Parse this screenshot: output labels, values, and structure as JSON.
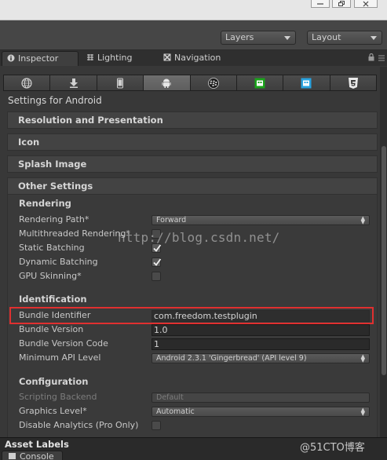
{
  "toolbar": {
    "layers_label": "Layers",
    "layout_label": "Layout"
  },
  "tabs": [
    {
      "label": "Inspector"
    },
    {
      "label": "Lighting"
    },
    {
      "label": "Navigation"
    }
  ],
  "platforms": [
    "globe-icon",
    "download-icon",
    "phone-icon",
    "android-icon",
    "blackberry-icon",
    "windows-store-green-icon",
    "windows-store-blue-icon",
    "html5-icon"
  ],
  "settings_for": "Settings for Android",
  "sections": {
    "resolution": "Resolution and Presentation",
    "icon": "Icon",
    "splash": "Splash Image",
    "other": "Other Settings"
  },
  "rendering": {
    "heading": "Rendering",
    "rendering_path_label": "Rendering Path*",
    "rendering_path_value": "Forward",
    "multithreaded_label": "Multithreaded Rendering*",
    "multithreaded_checked": false,
    "static_batching_label": "Static Batching",
    "static_batching_checked": true,
    "dynamic_batching_label": "Dynamic Batching",
    "dynamic_batching_checked": true,
    "gpu_skinning_label": "GPU Skinning*",
    "gpu_skinning_checked": false
  },
  "identification": {
    "heading": "Identification",
    "bundle_identifier_label": "Bundle Identifier",
    "bundle_identifier_value": "com.freedom.testplugin",
    "bundle_version_label": "Bundle Version",
    "bundle_version_value": "1.0",
    "bundle_version_code_label": "Bundle Version Code",
    "bundle_version_code_value": "1",
    "min_api_label": "Minimum API Level",
    "min_api_value": "Android 2.3.1 'Gingerbread' (API level 9)"
  },
  "configuration": {
    "heading": "Configuration",
    "scripting_backend_label": "Scripting Backend",
    "scripting_backend_value": "Default",
    "graphics_level_label": "Graphics Level*",
    "graphics_level_value": "Automatic",
    "disable_analytics_label": "Disable Analytics (Pro Only)",
    "disable_analytics_checked": false
  },
  "watermark": "http://blog.csdn.net/",
  "bottom": {
    "asset_labels": "Asset Labels",
    "console_tab": "Console",
    "credit": "@51CTO博客"
  },
  "colors": {
    "highlight_box": "#e03030",
    "android_active": "#6a6a6a",
    "windows_green": "#1aa31a",
    "windows_blue": "#29a3e0",
    "html5": "#e9e9e9"
  }
}
